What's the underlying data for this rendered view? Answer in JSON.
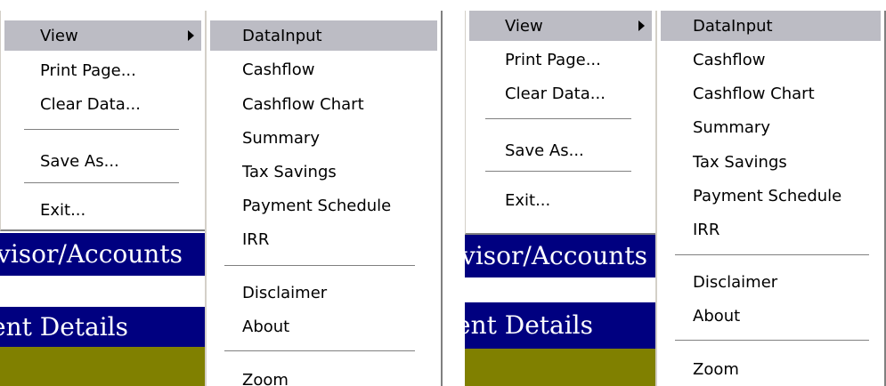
{
  "app": {
    "banner1": "visor/Accounts",
    "banner2": "ent Details"
  },
  "menu": {
    "view": "View",
    "print": "Print Page...",
    "clear": "Clear Data...",
    "save": "Save As...",
    "exit": "Exit..."
  },
  "submenu": {
    "datainput": "DataInput",
    "cashflow": "Cashflow",
    "cashflow_chart": "Cashflow Chart",
    "summary": "Summary",
    "tax": "Tax Savings",
    "payment": "Payment Schedule",
    "irr": "IRR",
    "disclaimer": "Disclaimer",
    "about": "About",
    "zoom": "Zoom"
  },
  "colors": {
    "highlight": "#bcbcc4",
    "banner_blue": "#000080",
    "banner_olive": "#808000"
  }
}
